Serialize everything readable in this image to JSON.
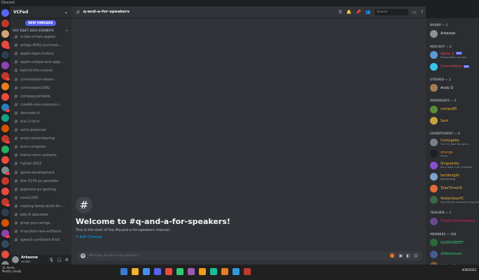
{
  "os": {
    "window_title": "Discord"
  },
  "guild": {
    "name": "VCFed",
    "new_unreads": "NEW UNREADS",
    "category": "VCF EAST 2022 EXHIBITS",
    "channels": [
      "a-tale-of-two-apples",
      "amiga-4091-scsi-host-...",
      "apple-logos-history",
      "apple-unique-and-upgr...",
      "behind-the-scenes",
      "commodore-reborn",
      "commodore1982",
      "compaq-portable",
      "core64-core-memory-i...",
      "decmate-iii",
      "dial-1-for-it",
      "early-power-pc",
      "eniac-remembering",
      "euro-computer",
      "foenix-retro-systems",
      "fujinet-2022",
      "game-development",
      "ibm-5155-pc-portable",
      "japanese-pc-gaming",
      "nova1200",
      "making-tandy-work-for-...",
      "pdp-8-spacewar",
      "pimp-your-amiga",
      "rf-auction-rare-artifacts",
      "speech-synthesis-8-bit"
    ]
  },
  "user": {
    "name": "Arkazow",
    "tag": "#0386"
  },
  "channel": {
    "name": "q-and-a-for-speakers",
    "search_placeholder": "Search",
    "welcome_title": "Welcome to #q-and-a-for-speakers!",
    "welcome_desc": "This is the start of the #q-and-a-for-speakers channel.",
    "edit_channel": "Edit Channel",
    "composer_placeholder": "Message #q-and-a-for-speakers"
  },
  "members": {
    "groups": [
      {
        "title": "BOARD — 1",
        "list": [
          {
            "name": "Arkazow",
            "color": "#dbdee1",
            "avatar": "#8e9297"
          }
        ]
      },
      {
        "title": "MOD BOT — 2",
        "list": [
          {
            "name": "Apple ][ ",
            "color": "#f23f43",
            "avatar": "#5a9bd5",
            "activity": "Playing Hello I am gay",
            "bot": "BOT"
          },
          {
            "name": "Commodore ",
            "color": "#f23f43",
            "avatar": "#3ac3ec",
            "bot": "BOT"
          }
        ]
      },
      {
        "title": "STEERED — 1",
        "list": [
          {
            "name": "Andy D",
            "color": "#dbdee1",
            "avatar": "#a67c52"
          }
        ]
      },
      {
        "title": "REPAIRDAYS — 2",
        "list": [
          {
            "name": "compu85",
            "color": "#f0b232",
            "avatar": "#5b8c3a"
          },
          {
            "name": "Sark",
            "color": "#f0b232",
            "avatar": "#c9a23f"
          }
        ]
      },
      {
        "title": "EXHIBITIONIST — 8",
        "list": [
          {
            "name": "Compgeke",
            "color": "#f0b232",
            "avatar": "#7a7f87",
            "activity": "Turn On, Boot Up, Jack In"
          },
          {
            "name": "orange",
            "color": "#e67e22",
            "avatar": "#1e1f22",
            "activity": "Tracks"
          },
          {
            "name": "Singularity",
            "color": "#f0b232",
            "avatar": "#8a4fd0",
            "activity": "Don't bask in the Chevrolet"
          },
          {
            "name": "techknight",
            "color": "#f0b232",
            "avatar": "#7fa2c8",
            "activity": "Retrofitching"
          },
          {
            "name": "TubeTimeUS",
            "color": "#f0b232",
            "avatar": "#e06c3a"
          },
          {
            "name": "YesterGearPC",
            "color": "#f0b232",
            "avatar": "#3a6a4a",
            "activity": "Your friendly electronics engineer"
          }
        ]
      },
      {
        "title": "TEACHER — 1",
        "list": [
          {
            "name": "Thom Cherryhomes",
            "color": "#e91e63",
            "avatar": "#6a4a8a"
          }
        ]
      },
      {
        "title": "MEMBERS — 108",
        "list": [
          {
            "name": "0xDEADBEEF",
            "color": "#2ecc71",
            "avatar": "#2b6b3a"
          },
          {
            "name": "256byteram",
            "color": "#2ecc71",
            "avatar": "#4a5a8a"
          },
          {
            "name": "Adrian G.",
            "color": "#2ecc71",
            "avatar": "#7a5a3a"
          }
        ]
      }
    ]
  },
  "taskbar": {
    "status_line1": "11 Alerts",
    "status_line2": "Mostly cloudy",
    "clock_date": "4/30/2022"
  },
  "colors": {
    "accent": "#5865f2",
    "link": "#00a8fc",
    "servers": [
      "#5865f2",
      "#c0392b",
      "#d4a373",
      "#e74c3c",
      "#2c3e50",
      "#8e44ad",
      "#c0392b",
      "#e67e22",
      "#e74c3c",
      "#2980b9",
      "#16a085",
      "#d35400",
      "#c0392b",
      "#27ae60",
      "#e74c3c",
      "#7f8c8d",
      "#c0392b",
      "#e74c3c",
      "#c0392b",
      "#2c3e50",
      "#d35400",
      "#8e44ad",
      "#34495e",
      "#e74c3c",
      "#7f8c8d",
      "#4a4d55"
    ]
  }
}
